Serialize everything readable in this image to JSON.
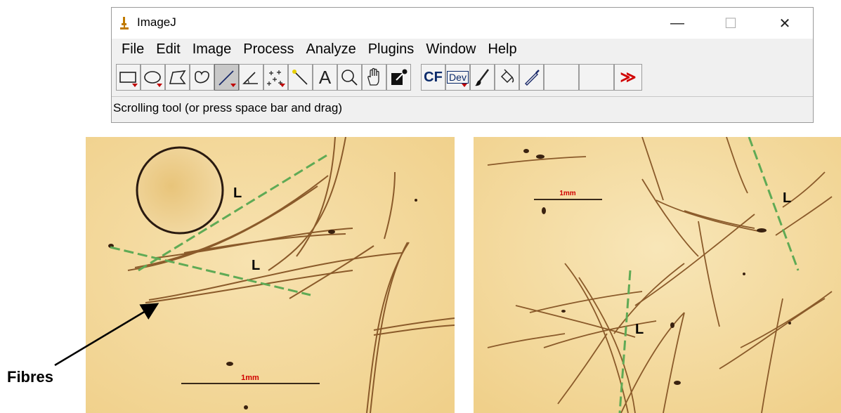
{
  "window": {
    "title": "ImageJ",
    "minimize_glyph": "—",
    "maximize_glyph": "☐",
    "close_glyph": "✕"
  },
  "menu": [
    "File",
    "Edit",
    "Image",
    "Process",
    "Analyze",
    "Plugins",
    "Window",
    "Help"
  ],
  "toolbar": {
    "tools": [
      {
        "name": "rectangle-tool",
        "has_menu": true
      },
      {
        "name": "oval-tool",
        "has_menu": true
      },
      {
        "name": "polygon-tool",
        "has_menu": false
      },
      {
        "name": "freehand-tool",
        "has_menu": false
      },
      {
        "name": "line-tool",
        "has_menu": true,
        "active": true
      },
      {
        "name": "angle-tool",
        "has_menu": false
      },
      {
        "name": "multipoint-tool",
        "has_menu": true
      },
      {
        "name": "wand-tool",
        "has_menu": false
      },
      {
        "name": "text-tool",
        "has_menu": false
      },
      {
        "name": "magnifying-glass-tool",
        "has_menu": false
      },
      {
        "name": "scrolling-tool",
        "has_menu": false
      },
      {
        "name": "color-picker-tool",
        "has_menu": false
      },
      {
        "name": "cf-tool",
        "has_menu": false
      },
      {
        "name": "dev-tool",
        "has_menu": true
      },
      {
        "name": "brush-tool",
        "has_menu": false
      },
      {
        "name": "flood-fill-tool",
        "has_menu": false
      },
      {
        "name": "pencil-tool",
        "has_menu": false
      },
      {
        "name": "empty-slot",
        "has_menu": false
      },
      {
        "name": "empty-slot",
        "has_menu": false
      },
      {
        "name": "more-tools",
        "has_menu": false
      }
    ],
    "text_glyph": "A",
    "cf_label": "CF",
    "dev_label": "Dev",
    "more_glyph": "≫"
  },
  "status": "Scrolling tool (or press space bar and drag)",
  "images": {
    "left": {
      "scale_label": "1mm",
      "length_labels": [
        "L",
        "L"
      ]
    },
    "right": {
      "scale_label": "1mm",
      "length_labels": [
        "L",
        "L"
      ]
    }
  },
  "annotation": {
    "fibres_label": "Fibres"
  },
  "colors": {
    "background_image": "#f3d89b",
    "fibre": "#8a5a2a",
    "measure_line": "#5faa55",
    "scale_text": "#d00000",
    "active_tool": "#c8c8c8"
  }
}
